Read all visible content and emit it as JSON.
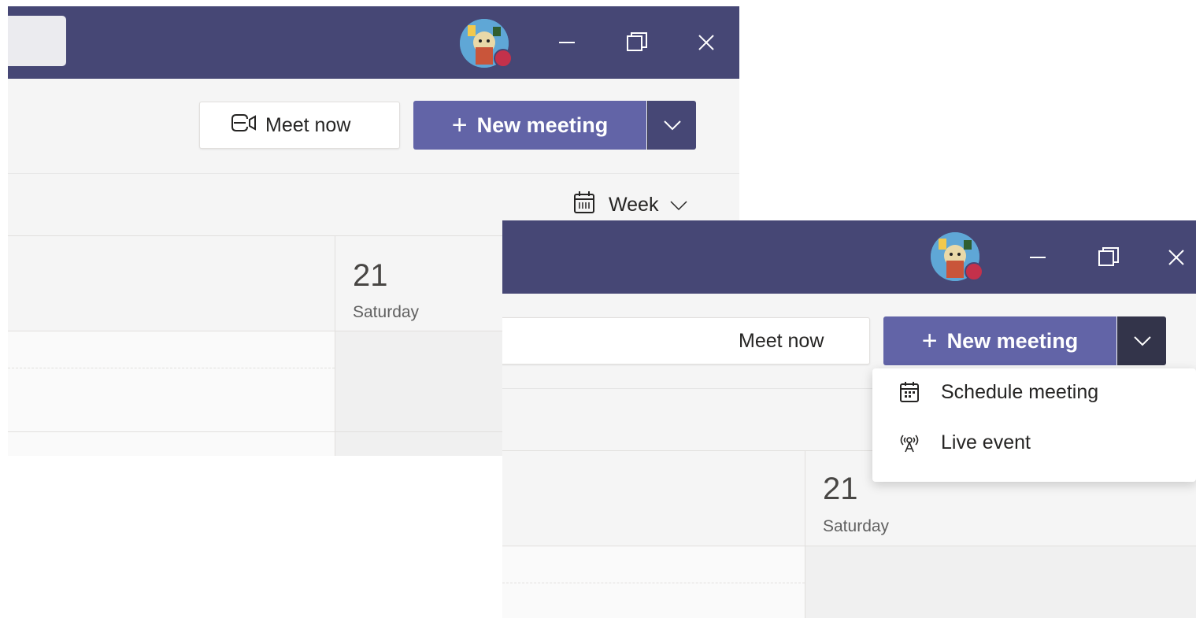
{
  "screens": [
    {
      "toolbar": {
        "meet_now_label": "Meet now",
        "new_meeting_label": "New meeting",
        "plus_glyph": "+"
      },
      "view_switcher": {
        "label": "Week"
      },
      "day": {
        "number": "21",
        "name": "Saturday"
      }
    },
    {
      "toolbar": {
        "meet_now_label": "Meet now",
        "new_meeting_label": "New meeting",
        "plus_glyph": "+"
      },
      "dropdown": {
        "items": [
          {
            "label": "Schedule meeting",
            "icon": "calendar-icon"
          },
          {
            "label": "Live event",
            "icon": "broadcast-icon"
          }
        ]
      },
      "day": {
        "number": "21",
        "name": "Saturday"
      }
    }
  ],
  "colors": {
    "titlebar": "#464775",
    "brand": "#6264a7",
    "brand_dark": "#464775",
    "presence_busy": "#c4314b",
    "background": "#f5f5f5"
  }
}
